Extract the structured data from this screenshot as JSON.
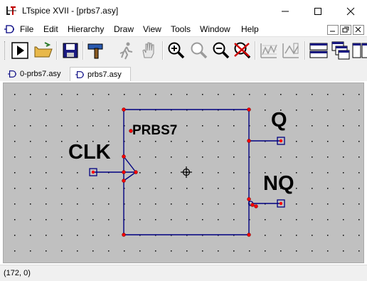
{
  "window": {
    "title": "LTspice XVII - [prbs7.asy]",
    "minimize_label": "—",
    "maximize_label": "☐",
    "close_label": "✕"
  },
  "menubar": {
    "items": [
      "File",
      "Edit",
      "Hierarchy",
      "Draw",
      "View",
      "Tools",
      "Window",
      "Help"
    ]
  },
  "toolbar": {
    "buttons": [
      "run-icon",
      "open-icon",
      "save-icon",
      "hammer-icon",
      "move-icon",
      "drag-hand-icon",
      "zoom-in-icon",
      "zoom-pan-icon",
      "zoom-out-icon",
      "zoom-cancel-icon",
      "plot-settings-icon",
      "plot-edit-icon",
      "tile-horizontal-icon",
      "cascade-icon",
      "tile-vertical-icon"
    ]
  },
  "tabs": [
    {
      "label": "0-prbs7.asy",
      "active": false
    },
    {
      "label": "prbs7.asy",
      "active": true
    }
  ],
  "schematic": {
    "symbol_name": "PRBS7",
    "pins": [
      "CLK",
      "Q",
      "NQ"
    ],
    "colors": {
      "background": "#c0c0c0",
      "wire": "#000080",
      "pin_marker": "#ff0000",
      "grid_dot": "#000000"
    }
  },
  "statusbar": {
    "coordinates": "(172, 0)"
  }
}
